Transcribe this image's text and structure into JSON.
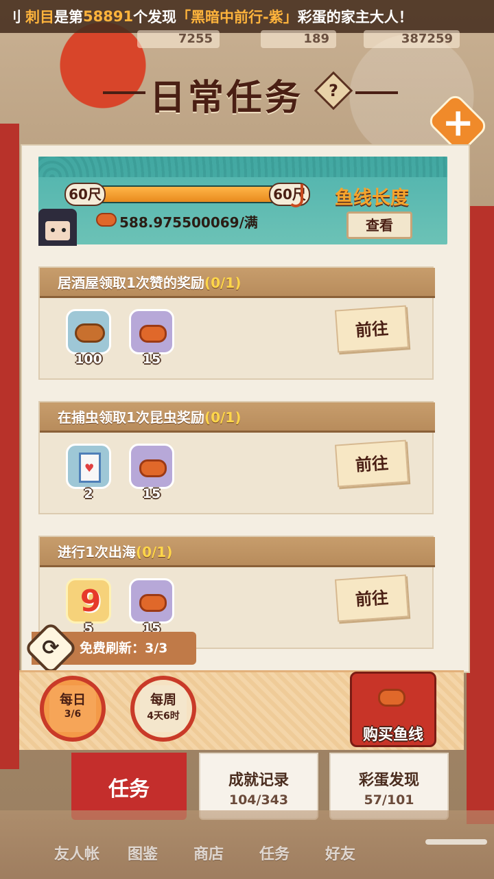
{
  "marquee": {
    "prefix": "刂",
    "player": "刺目",
    "text1": "是第",
    "rank": "58891",
    "text2": "个发现",
    "egg": "「黑暗中前行-紫」",
    "text3": "彩蛋的家主大人！"
  },
  "resources": [
    "7255",
    "189",
    "387259"
  ],
  "title": "日常任务",
  "help_label": "?",
  "close_label": "+",
  "line": {
    "current": "60尺",
    "max": "60尺",
    "fill_fraction": 1.0,
    "amount": "588.975500069/满",
    "title": "鱼线长度",
    "view_label": "查看"
  },
  "tasks": [
    {
      "title": "居酒屋领取1次赞的奖励",
      "progress": "(0/1)",
      "rewards": [
        {
          "icon": "wood-logs-icon",
          "count": "100"
        },
        {
          "icon": "fishing-line-icon",
          "count": "15"
        }
      ],
      "action": "前往"
    },
    {
      "title": "在捕虫领取1次昆虫奖励",
      "progress": "(0/1)",
      "rewards": [
        {
          "icon": "milk-carton-icon",
          "count": "2"
        },
        {
          "icon": "fishing-line-icon",
          "count": "15"
        }
      ],
      "action": "前往"
    },
    {
      "title": "进行1次出海",
      "progress": "(0/1)",
      "rewards": [
        {
          "icon": "nine-token-icon",
          "count": "5"
        },
        {
          "icon": "fishing-line-icon",
          "count": "15"
        }
      ],
      "action": "前往"
    }
  ],
  "refresh": {
    "label": "免费刷新：3/3"
  },
  "periods": {
    "daily": {
      "label": "每日",
      "value": "3/6"
    },
    "weekly": {
      "label": "每周",
      "value": "4天6时"
    }
  },
  "buy_line": {
    "label": "购买鱼线"
  },
  "category_tabs": [
    {
      "title": "任务",
      "count": ""
    },
    {
      "title": "成就记录",
      "count": "104/343"
    },
    {
      "title": "彩蛋发现",
      "count": "57/101"
    }
  ],
  "bottom_nav": [
    "友人帐",
    "图鉴",
    "商店",
    "任务",
    "好友"
  ],
  "colors": {
    "accent_red": "#c42e2c",
    "banner_teal": "#4fb3ad",
    "progress_gold": "#ffd64a",
    "title_brown": "#4a1f14"
  }
}
